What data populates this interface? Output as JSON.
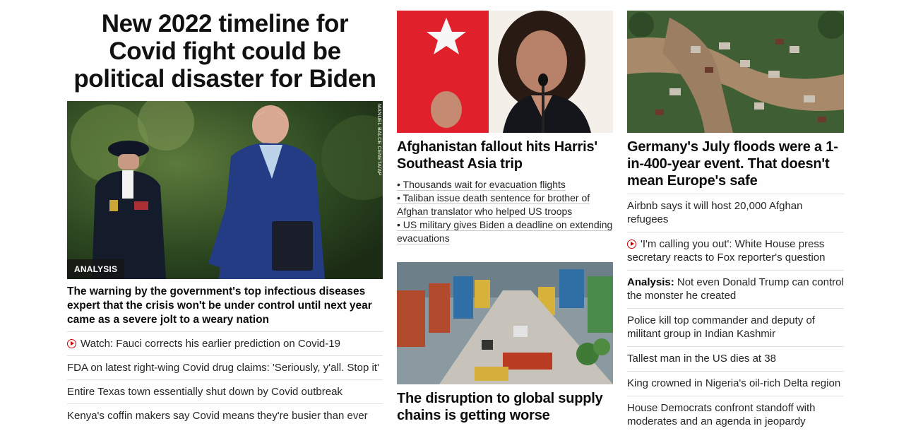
{
  "col1": {
    "hero_title": "New 2022 timeline for Covid fight could be political disaster for Biden",
    "badge": "ANALYSIS",
    "photo_credit": "MANUEL BALCE CENETA/AP",
    "headline": "The warning by the government's top infectious diseases expert that the crisis won't be under control until next year came as a severe jolt to a weary nation",
    "links": [
      {
        "text": "Watch: Fauci corrects his earlier prediction on Covid-19",
        "icon": "play-icon"
      },
      {
        "text": "FDA on latest right-wing Covid drug claims: 'Seriously, y'all. Stop it'"
      },
      {
        "text": "Entire Texas town essentially shut down by Covid outbreak"
      },
      {
        "text": "Kenya's coffin makers say Covid means they're busier than ever"
      }
    ]
  },
  "col2": {
    "harris_headline": "Afghanistan fallout hits Harris' Southeast Asia trip",
    "bullets": [
      "• Thousands wait for evacuation flights",
      "• Taliban issue death sentence for brother of Afghan translator who helped US troops",
      "• US military gives Biden a deadline on extending evacuations"
    ],
    "port_headline": "The disruption to global supply chains is getting worse"
  },
  "col3": {
    "flood_headline": "Germany's July floods were a 1-in-400-year event. That doesn't mean Europe's safe",
    "links": [
      {
        "text": "Airbnb says it will host 20,000 Afghan refugees"
      },
      {
        "text": "'I'm calling you out': White House press secretary reacts to Fox reporter's question",
        "icon": "play-icon"
      },
      {
        "prefix": "Analysis:",
        "text": " Not even Donald Trump can control the monster he created"
      },
      {
        "text": "Police kill top commander and deputy of militant group in Indian Kashmir"
      },
      {
        "text": "Tallest man in the US dies at 38"
      },
      {
        "text": "King crowned in Nigeria's oil-rich Delta region"
      },
      {
        "text": "House Democrats confront standoff with moderates and an agenda in jeopardy"
      }
    ]
  },
  "colors": {
    "accent": "#cc0000",
    "text": "#0c0c0c",
    "divider": "#e0e0e0"
  }
}
